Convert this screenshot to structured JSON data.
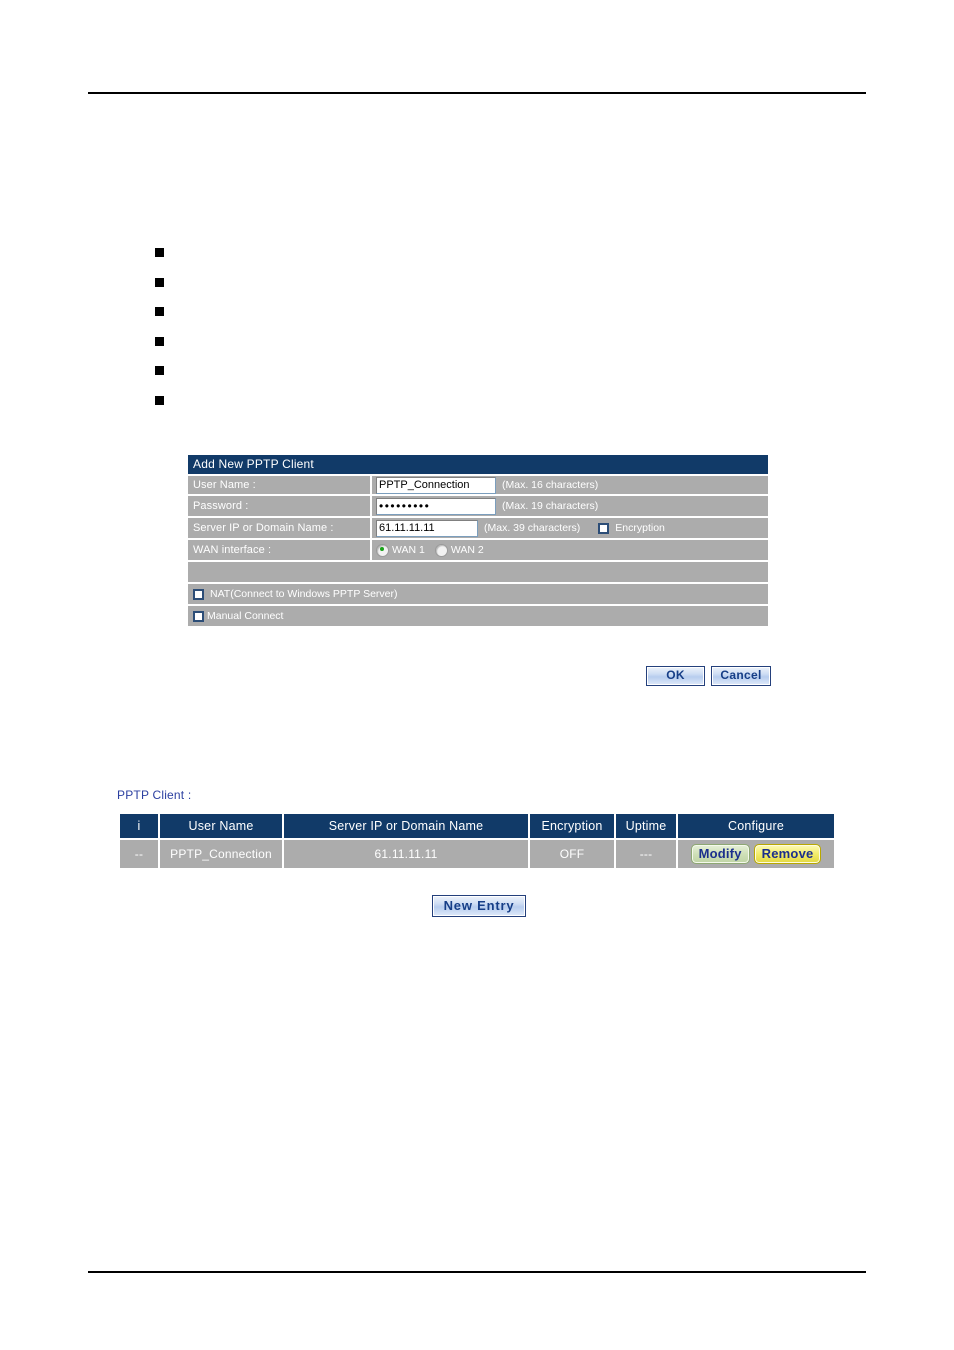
{
  "bullets": [
    {
      "text": ""
    },
    {
      "text": ""
    },
    {
      "text": ""
    },
    {
      "text": ""
    },
    {
      "text": ""
    },
    {
      "text": ""
    }
  ],
  "dialog": {
    "title": "Add New PPTP Client",
    "rows": {
      "user_name": {
        "label": "User Name  :",
        "value": "PPTP_Connection",
        "hint": "(Max. 16 characters)"
      },
      "password": {
        "label": "Password  :",
        "value": "•••••••••",
        "hint": "(Max. 19 characters)"
      },
      "server": {
        "label": "Server IP or Domain Name :",
        "value": "61.11.11.11",
        "hint": "(Max. 39 characters)",
        "encryption_label": "Encryption"
      },
      "wan": {
        "label": "WAN interface :",
        "options": [
          {
            "label": "WAN 1",
            "selected": true
          },
          {
            "label": "WAN 2",
            "selected": false
          }
        ]
      },
      "nat": {
        "label": "NAT(Connect to Windows PPTP Server)",
        "checked": false
      },
      "manual_connect": {
        "label": "Manual Connect",
        "checked": false
      }
    },
    "buttons": {
      "ok": "OK",
      "cancel": "Cancel"
    }
  },
  "client_section": {
    "label": "PPTP Client :",
    "columns": [
      "i",
      "User Name",
      "Server IP or Domain Name",
      "Encryption",
      "Uptime",
      "Configure"
    ],
    "rows": [
      {
        "i": "--",
        "user_name": "PPTP_Connection",
        "server": "61.11.11.11",
        "encryption": "OFF",
        "uptime": "---",
        "modify": "Modify",
        "remove": "Remove"
      }
    ],
    "new_entry": "New  Entry"
  },
  "colors": {
    "header_navy": "#113A68",
    "row_gray": "#ACACAC",
    "link_blue": "#2B3FA0",
    "button_text": "#163E87",
    "radio_green": "#19A319"
  }
}
